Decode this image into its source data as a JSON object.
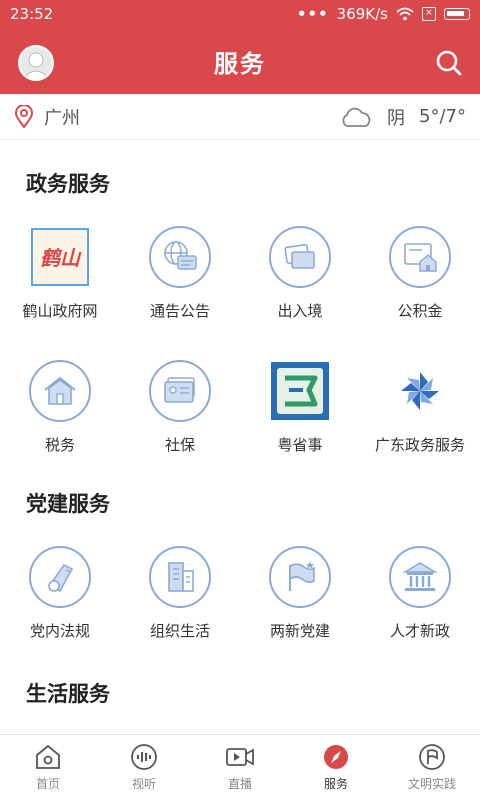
{
  "status_bar": {
    "time": "23:52",
    "net_speed": "369K/s"
  },
  "header": {
    "title": "服务"
  },
  "location": {
    "city": "广州",
    "weather": "阴",
    "temperature": "5°/7°"
  },
  "sections": [
    {
      "title": "政务服务",
      "items": [
        {
          "label": "鹤山政府网",
          "icon": "heshan-logo-icon"
        },
        {
          "label": "通告公告",
          "icon": "notice-icon"
        },
        {
          "label": "出入境",
          "icon": "passport-icon"
        },
        {
          "label": "公积金",
          "icon": "housing-fund-icon"
        },
        {
          "label": "税务",
          "icon": "tax-house-icon"
        },
        {
          "label": "社保",
          "icon": "social-security-card-icon"
        },
        {
          "label": "粤省事",
          "icon": "yueshengshi-logo-icon"
        },
        {
          "label": "广东政务服务",
          "icon": "guangdong-gov-logo-icon"
        }
      ]
    },
    {
      "title": "党建服务",
      "items": [
        {
          "label": "党内法规",
          "icon": "whistle-icon"
        },
        {
          "label": "组织生活",
          "icon": "building-icon"
        },
        {
          "label": "两新党建",
          "icon": "flag-icon"
        },
        {
          "label": "人才新政",
          "icon": "institution-icon"
        }
      ]
    },
    {
      "title": "生活服务"
    }
  ],
  "heshan_logo_text": "鹤山",
  "tabbar": [
    {
      "label": "首页",
      "icon": "home-icon"
    },
    {
      "label": "视听",
      "icon": "audio-icon"
    },
    {
      "label": "直播",
      "icon": "video-icon"
    },
    {
      "label": "服务",
      "icon": "compass-icon",
      "active": true
    },
    {
      "label": "文明实践",
      "icon": "flag-circle-icon"
    }
  ],
  "colors": {
    "brand_red": "#d9484b",
    "icon_blue": "#8aaad6"
  }
}
